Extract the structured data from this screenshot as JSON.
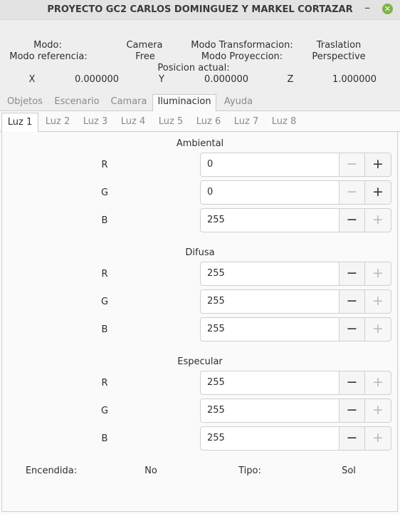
{
  "window": {
    "title": "PROYECTO GC2 CARLOS DOMINGUEZ Y MARKEL CORTAZAR",
    "minimize": "–",
    "close": "✕"
  },
  "info": {
    "modo_label": "Modo:",
    "modo_value": "Camera",
    "transform_label": "Modo Transformacion:",
    "transform_value": "Traslation",
    "referencia_label": "Modo referencia:",
    "referencia_value": "Free",
    "proyeccion_label": "Modo Proyeccion:",
    "proyeccion_value": "Perspective",
    "posicion_label": "Posicion actual:",
    "x_label": "X",
    "x_value": "0.000000",
    "y_label": "Y",
    "y_value": "0.000000",
    "z_label": "Z",
    "z_value": "1.000000"
  },
  "main_tabs": [
    "Objetos",
    "Escenario",
    "Camara",
    "Iluminacion",
    "Ayuda"
  ],
  "light_tabs": [
    "Luz 1",
    "Luz 2",
    "Luz 3",
    "Luz 4",
    "Luz 5",
    "Luz 6",
    "Luz 7",
    "Luz 8"
  ],
  "sections": {
    "ambiental": {
      "title": "Ambiental",
      "r_label": "R",
      "r_value": "0",
      "g_label": "G",
      "g_value": "0",
      "b_label": "B",
      "b_value": "255"
    },
    "difusa": {
      "title": "Difusa",
      "r_label": "R",
      "r_value": "255",
      "g_label": "G",
      "g_value": "255",
      "b_label": "B",
      "b_value": "255"
    },
    "especular": {
      "title": "Especular",
      "r_label": "R",
      "r_value": "255",
      "g_label": "G",
      "g_value": "255",
      "b_label": "B",
      "b_value": "255"
    }
  },
  "spin_buttons": {
    "minus": "−",
    "plus": "+"
  },
  "footer": {
    "encendida_label": "Encendida:",
    "encendida_value": "No",
    "tipo_label": "Tipo:",
    "tipo_value": "Sol"
  }
}
